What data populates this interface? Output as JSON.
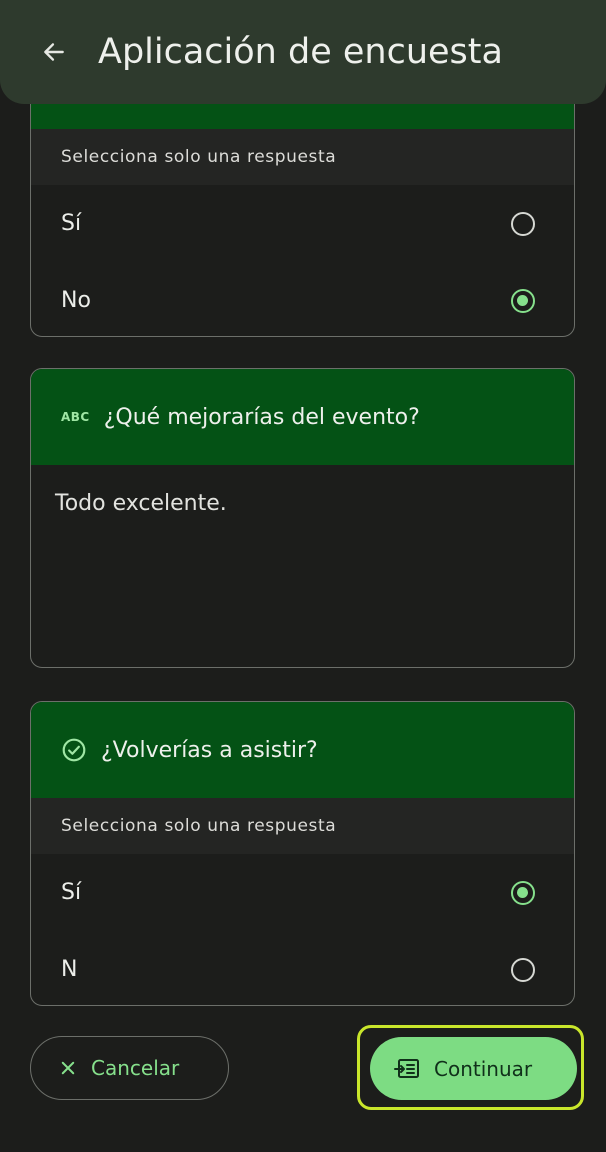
{
  "app_bar": {
    "title": "Aplicación de encuesta",
    "back_icon": "arrow-back-icon"
  },
  "question_1": {
    "hint": "Selecciona solo una respuesta",
    "options": [
      {
        "label": "Sí",
        "selected": false
      },
      {
        "label": "No",
        "selected": true
      }
    ]
  },
  "question_2": {
    "icon": "abc-text-icon",
    "icon_text": "ABC",
    "title": "¿Qué mejorarías del evento?",
    "answer": "Todo excelente."
  },
  "question_3": {
    "icon": "check-circle-icon",
    "title": "¿Volverías a asistir?",
    "hint": "Selecciona solo una respuesta",
    "options": [
      {
        "label": "Sí",
        "selected": true
      },
      {
        "label": "N",
        "selected": false
      }
    ]
  },
  "actions": {
    "cancel_label": "Cancelar",
    "cancel_icon": "close-icon",
    "continue_label": "Continuar",
    "continue_icon": "form-icon"
  },
  "colors": {
    "background": "#1c1d1b",
    "header_green": "#045215",
    "accent": "#86e08c",
    "focus": "#c9e62b"
  }
}
